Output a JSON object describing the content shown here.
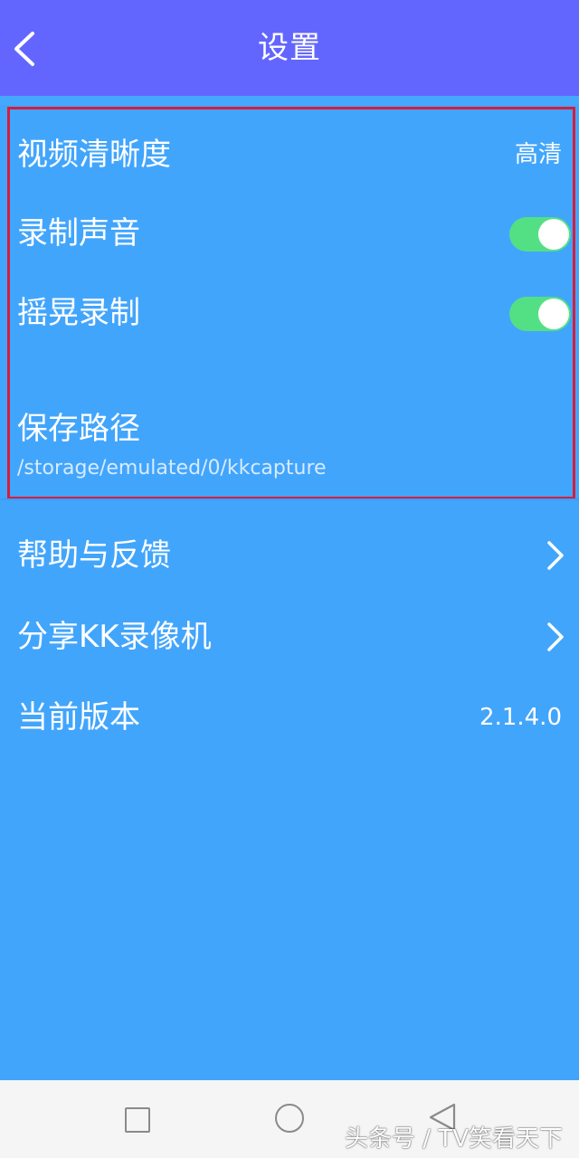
{
  "header": {
    "title": "设置",
    "back_icon": "chevron-left-icon"
  },
  "settings": {
    "video_quality": {
      "label": "视频清晰度",
      "value": "高清"
    },
    "record_audio": {
      "label": "录制声音",
      "enabled": true
    },
    "shake_record": {
      "label": "摇晃录制",
      "enabled": true
    },
    "save_path": {
      "label": "保存路径",
      "value": "/storage/emulated/0/kkcapture"
    }
  },
  "menu": {
    "help": {
      "label": "帮助与反馈",
      "icon": "chevron-right-icon"
    },
    "share": {
      "label": "分享KK录像机",
      "icon": "chevron-right-icon"
    },
    "version": {
      "label": "当前版本",
      "value": "2.1.4.0"
    }
  },
  "navbar": {
    "icons": [
      "recent-apps-icon",
      "home-icon",
      "back-icon"
    ]
  },
  "watermark": "头条号 / TV笑看天下",
  "colors": {
    "header_bg": "#6366fe",
    "page_bg": "#42a5fc",
    "toggle_on": "#53e085",
    "highlight_border": "#d51d3c",
    "navbar_bg": "#f5f5f5"
  }
}
